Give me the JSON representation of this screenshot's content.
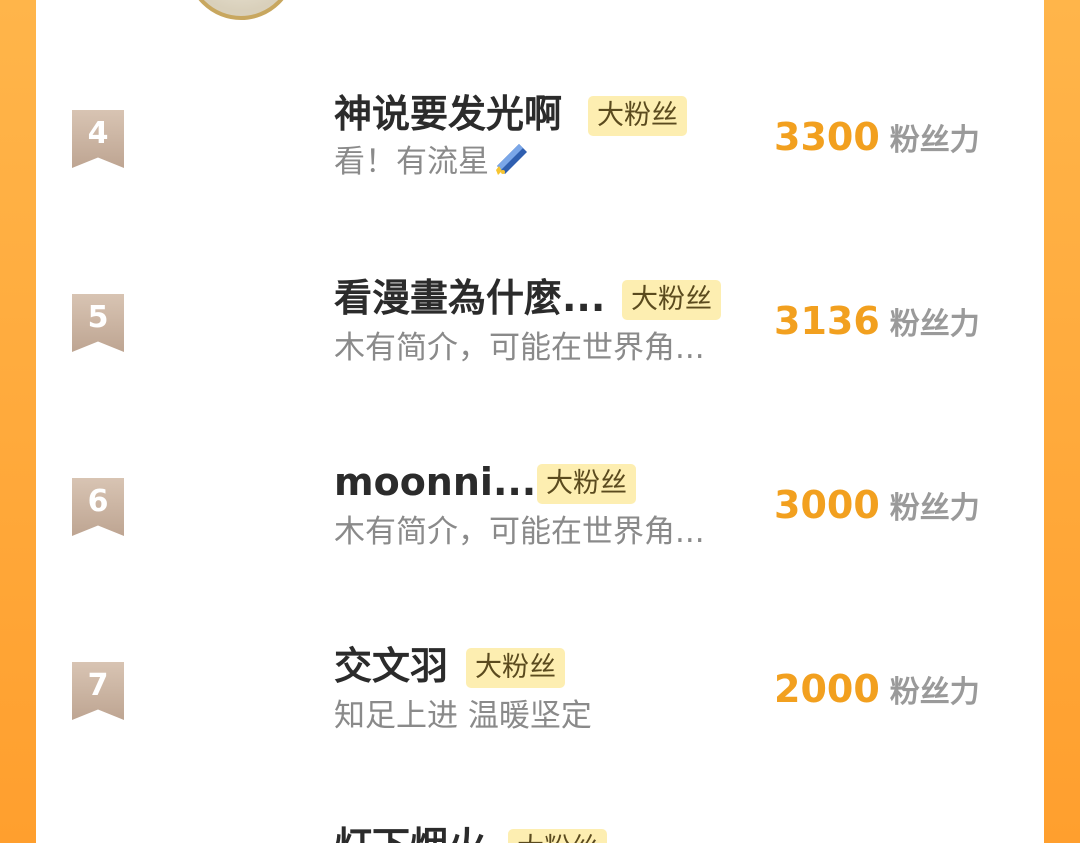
{
  "rankings": [
    {
      "rank": "4",
      "name": "神说要发光啊",
      "tag": "大粉丝",
      "desc": "看！有流星",
      "has_star_icon": true,
      "score": "3300",
      "unit": "粉丝力"
    },
    {
      "rank": "5",
      "name": "看漫畫為什麼...",
      "tag": "大粉丝",
      "desc": "木有简介，可能在世界角...",
      "has_star_icon": false,
      "score": "3136",
      "unit": "粉丝力"
    },
    {
      "rank": "6",
      "name": "moonni...",
      "tag": "大粉丝",
      "desc": "木有简介，可能在世界角...",
      "has_star_icon": false,
      "score": "3000",
      "unit": "粉丝力"
    },
    {
      "rank": "7",
      "name": "交文羽",
      "tag": "大粉丝",
      "desc": "知足上进 温暖坚定",
      "has_star_icon": false,
      "score": "2000",
      "unit": "粉丝力"
    }
  ],
  "partial_row": {
    "name": "灯下烟火",
    "tag": "大粉丝"
  },
  "colors": {
    "accent": "#f2a01f",
    "tag_bg": "#fdeeb1",
    "frame": "#ff9f2e"
  }
}
